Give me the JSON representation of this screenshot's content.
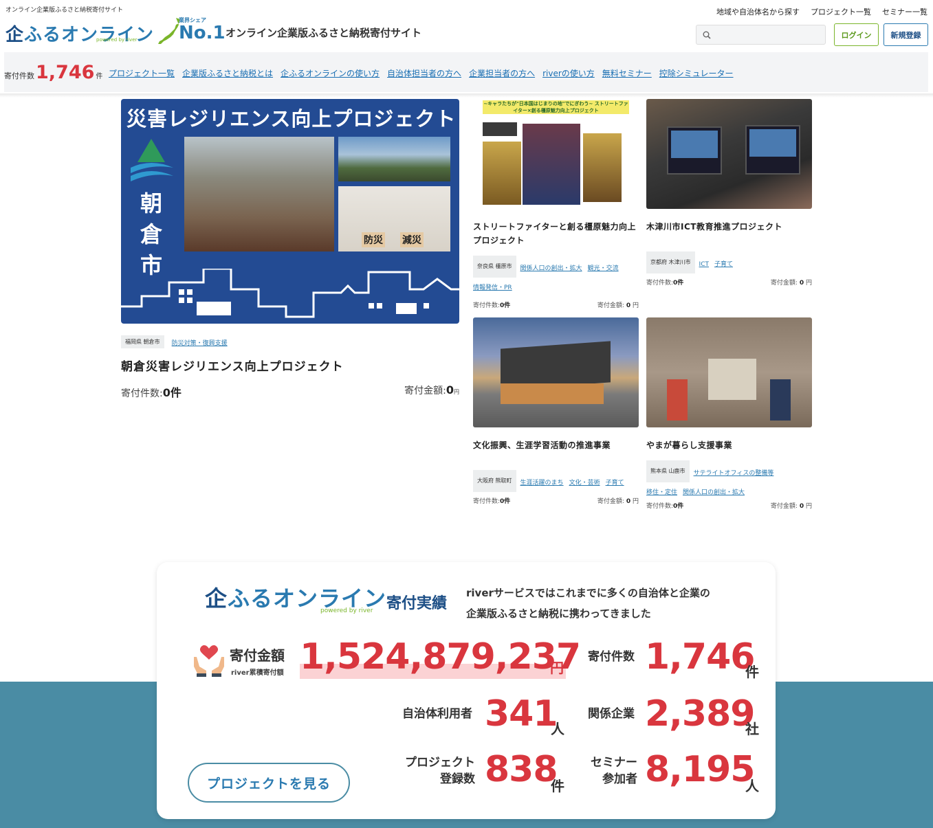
{
  "header": {
    "tagline": "オンライン企業版ふるさと納税寄付サイト",
    "logo_k": "企",
    "logo_text": "ふるオンライン",
    "logo_powered": "powered by river",
    "share_label": "業界シェア",
    "share_value": "No.1",
    "site_desc": "オンライン企業版ふるさと納税寄付サイト",
    "top_links": [
      "地域や自治体名から探す",
      "プロジェクト一覧",
      "セミナー一覧"
    ],
    "search_placeholder": "",
    "login_label": "ログイン",
    "signup_label": "新規登録"
  },
  "navbar": {
    "count_label": "寄付件数",
    "count_value": "1,746",
    "count_unit": "件",
    "links": [
      "プロジェクト一覧",
      "企業版ふるさと納税とは",
      "企ふるオンラインの使い方",
      "自治体担当者の方へ",
      "企業担当者の方へ",
      "riverの使い方",
      "無料セミナー",
      "控除シミュレーター"
    ]
  },
  "featured": {
    "image_title": "災害レジリエンス向上プロジェクト",
    "image_city": "朝倉市",
    "image_tags": [
      "防災",
      "減災"
    ],
    "location": "福岡県 朝倉市",
    "tags": [
      "防災対策・復興支援"
    ],
    "name": "朝倉災害レジリエンス向上プロジェクト",
    "count_label": "寄付件数:",
    "count_value": "0件",
    "amount_label": "寄付金額:",
    "amount_value": "0",
    "amount_unit": "円"
  },
  "cards": [
    {
      "image_caption": "~キャラたちが\"日本国はじまりの地\"でにぎわう~ ストリートファイター×創る橿原魅力向上プロジェクト",
      "name": "ストリートファイターと創る橿原魅力向上プロジェクト",
      "location": "奈良県 橿原市",
      "tags": [
        "関係人口の創出・拡大",
        "観光・交流",
        "情報発信・PR"
      ],
      "count_label": "寄付件数:",
      "count_value": "0件",
      "amount_label": "寄付金額:",
      "amount_value": "0",
      "amount_unit": "円"
    },
    {
      "name": "木津川市ICT教育推進プロジェクト",
      "location": "京都府 木津川市",
      "tags": [
        "ICT",
        "子育て"
      ],
      "count_label": "寄付件数:",
      "count_value": "0件",
      "amount_label": "寄付金額:",
      "amount_value": "0",
      "amount_unit": "円"
    },
    {
      "name": "文化振興、生涯学習活動の推進事業",
      "location": "大阪府 熊取町",
      "tags": [
        "生涯活躍のまち",
        "文化・芸術",
        "子育て"
      ],
      "count_label": "寄付件数:",
      "count_value": "0件",
      "amount_label": "寄付金額:",
      "amount_value": "0",
      "amount_unit": "円"
    },
    {
      "name": "やまが暮らし支援事業",
      "location": "熊本県 山鹿市",
      "tags": [
        "サテライトオフィスの整備等",
        "移住・定住",
        "関係人口の創出・拡大"
      ],
      "count_label": "寄付件数:",
      "count_value": "0件",
      "amount_label": "寄付金額:",
      "amount_value": "0",
      "amount_unit": "円"
    }
  ],
  "summary": {
    "logo_k": "企",
    "logo_text": "ふるオンライン",
    "logo_powered": "powered by river",
    "title": "寄付実績",
    "desc_line1": "riverサービスではこれまでに多くの自治体と企業の",
    "desc_line2": "企業版ふるさと納税に携わってきました",
    "amount_label": "寄付金額",
    "amount_sub": "river累積寄付額",
    "amount_value": "1,524,879,237",
    "amount_unit": "円",
    "stats": [
      {
        "label": "寄付件数",
        "value": "1,746",
        "unit": "件"
      },
      {
        "label": "自治体利用者",
        "value": "341",
        "unit": "人"
      },
      {
        "label": "関係企業",
        "value": "2,389",
        "unit": "社"
      },
      {
        "label_line1": "プロジェクト",
        "label_line2": "登録数",
        "value": "838",
        "unit": "件"
      },
      {
        "label_line1": "セミナー",
        "label_line2": "参加者",
        "value": "8,195",
        "unit": "人"
      }
    ],
    "button_label": "プロジェクトを見る"
  },
  "colors": {
    "brand_blue": "#2a7ab0",
    "brand_green": "#7ab52a",
    "accent_red": "#d9363e",
    "teal_band": "#4a8ca4"
  }
}
